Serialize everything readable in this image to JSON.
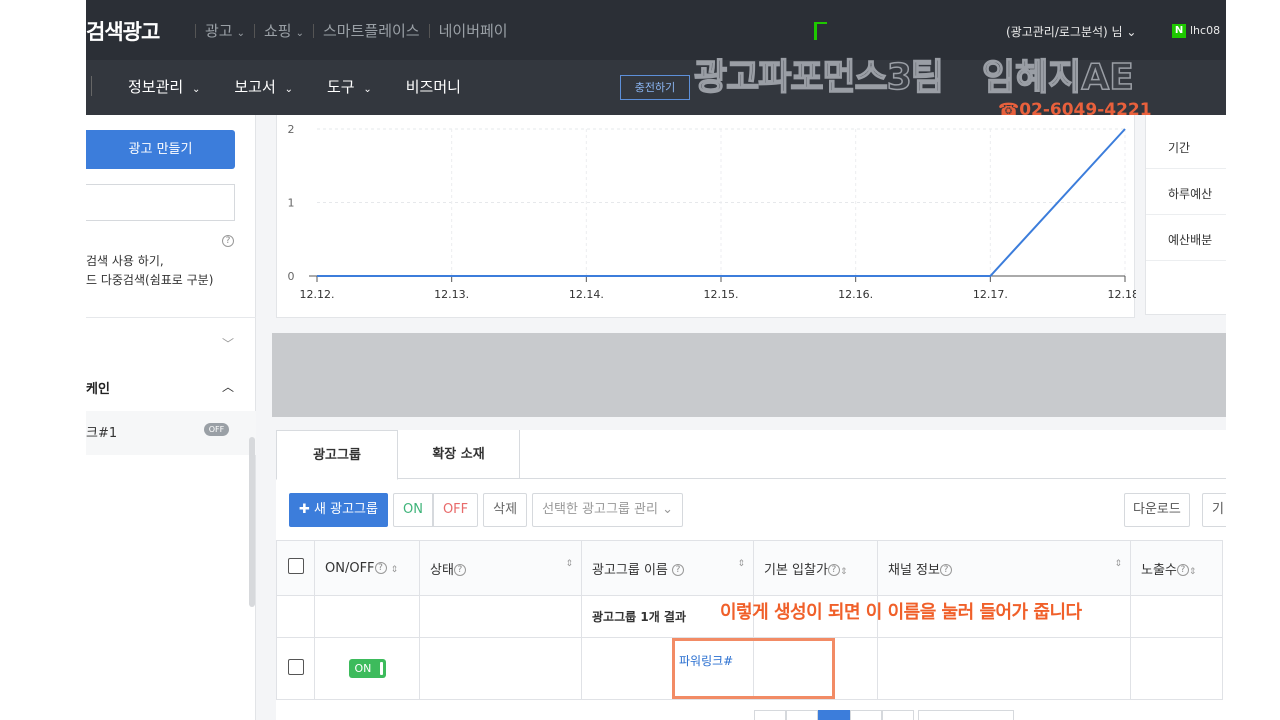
{
  "header": {
    "logo": "검색광고",
    "nav": [
      {
        "label": "광고",
        "chevron": true
      },
      {
        "label": "쇼핑",
        "chevron": true
      },
      {
        "label": "스마트플레이스",
        "chevron": false
      },
      {
        "label": "네이버페이",
        "chevron": false
      }
    ],
    "user_menu": "(광고관리/로그분석) 님",
    "naver_badge": "N",
    "user_id": "lhc08"
  },
  "subnav": {
    "items": [
      "정보관리",
      "보고서",
      "도구",
      "비즈머니"
    ],
    "charge_button": "충전하기"
  },
  "watermark": {
    "team": "광고파포먼스3팀",
    "name": "임혜지AE",
    "phone": "02-6049-4221"
  },
  "sidebar": {
    "create_ad_button": "광고 만들기",
    "search_placeholder": "",
    "help_icon": "?",
    "desc_line1": "검색 사용 하기,",
    "desc_line2": "드 다중검색(쉼표로 구분)",
    "campaign_label": "케인",
    "adgroup_item": "크#1",
    "adgroup_status": "OFF"
  },
  "chart_data": {
    "type": "line",
    "x": [
      "12.12.",
      "12.13.",
      "12.14.",
      "12.15.",
      "12.16.",
      "12.17.",
      "12.18."
    ],
    "series": [
      {
        "values": [
          0,
          0,
          0,
          0,
          0,
          0,
          2
        ]
      }
    ],
    "yticks": [
      "0",
      "1",
      "2"
    ],
    "ylim": [
      0,
      2
    ],
    "grid": true,
    "color": "#3c7ddb"
  },
  "info_panel": {
    "rows": [
      "기간",
      "하루예산",
      "예산배분"
    ]
  },
  "tabs": [
    "광고그룹",
    "확장 소재"
  ],
  "toolbar": {
    "new_group": "새 광고그룹",
    "on": "ON",
    "off": "OFF",
    "delete": "삭제",
    "manage": "선택한 광고그룹 관리",
    "download": "다운로드",
    "more": "기"
  },
  "table": {
    "headers": {
      "onoff": "ON/OFF",
      "status": "상태",
      "name": "광고그룹 이름",
      "bid": "기본 입찰가",
      "channel": "채널 정보",
      "impressions": "노출수"
    },
    "summary": "광고그룹 1개 결과",
    "rows": [
      {
        "toggle": "ON",
        "name": "파워링크#"
      }
    ]
  },
  "annotation": "이렇게 생성이 되면 이 이름을 눌러 들어가 줍니다"
}
